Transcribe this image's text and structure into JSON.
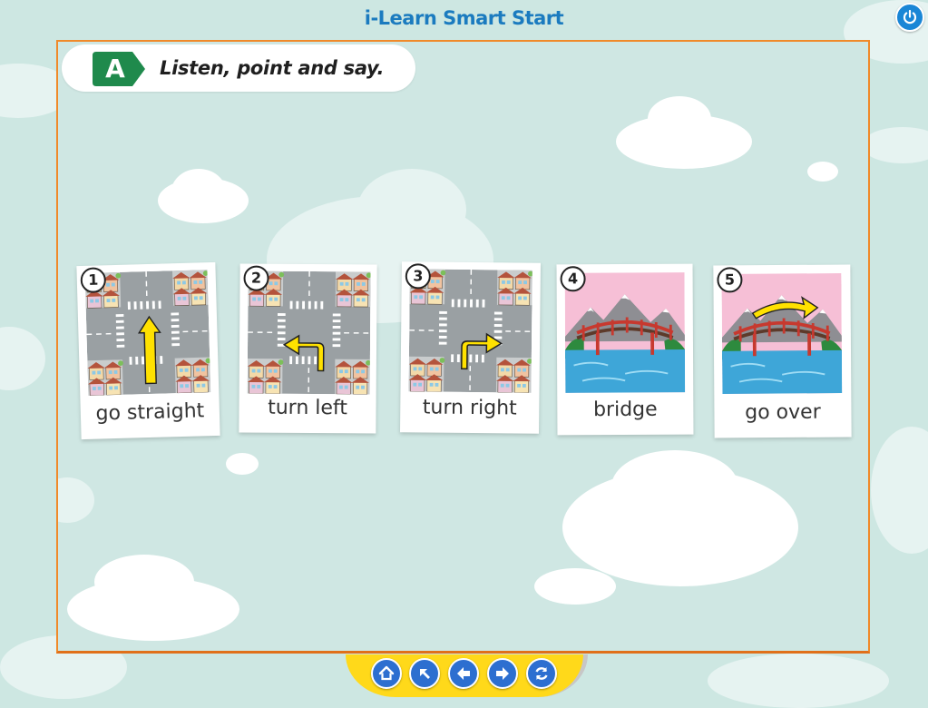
{
  "app": {
    "title": "i-Learn Smart Start"
  },
  "header": {
    "power_icon": "power-icon"
  },
  "activity": {
    "badge_letter": "A",
    "badge_color": "#1f8a4c",
    "instruction": "Listen, point and say."
  },
  "cards": [
    {
      "number": "1",
      "caption": "go straight",
      "scene": "crossroad",
      "arrow": "straight"
    },
    {
      "number": "2",
      "caption": "turn left",
      "scene": "crossroad",
      "arrow": "left"
    },
    {
      "number": "3",
      "caption": "turn right",
      "scene": "crossroad",
      "arrow": "right"
    },
    {
      "number": "4",
      "caption": "bridge",
      "scene": "bridge",
      "arrow": "none"
    },
    {
      "number": "5",
      "caption": "go over",
      "scene": "bridge",
      "arrow": "over"
    }
  ],
  "nav": [
    {
      "name": "home-button",
      "icon": "home-icon"
    },
    {
      "name": "back-to-menu-button",
      "icon": "arrow-up-left-icon"
    },
    {
      "name": "previous-button",
      "icon": "arrow-left-icon"
    },
    {
      "name": "next-button",
      "icon": "arrow-right-icon"
    },
    {
      "name": "replay-button",
      "icon": "refresh-icon"
    }
  ],
  "colors": {
    "title": "#1b7bbf",
    "frame": "#f08a2a",
    "arrow": "#ffe100",
    "navbar": "#ffd91a",
    "nav_button": "#2d6fd0"
  }
}
